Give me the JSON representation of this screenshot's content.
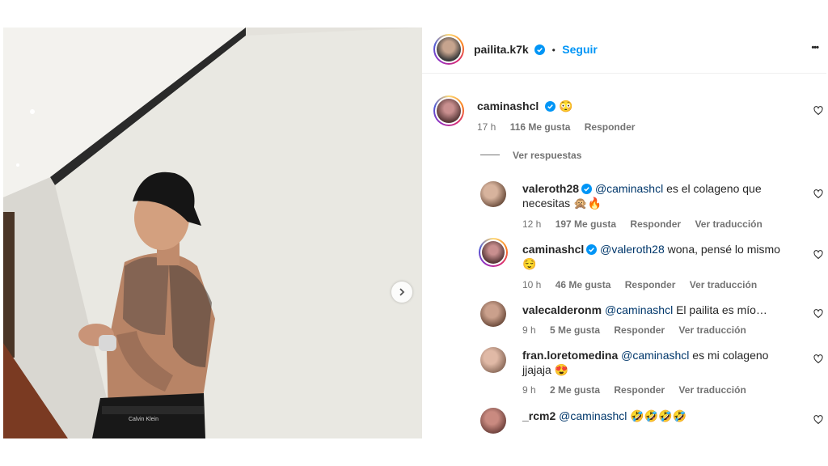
{
  "post": {
    "username": "pailita.k7k",
    "follow_label": "Seguir",
    "separator": "•",
    "more_label": "•••"
  },
  "main_comment": {
    "username": "caminashcl",
    "text": "😳",
    "time": "17 h",
    "likes": "116 Me gusta",
    "reply": "Responder"
  },
  "view_replies": "Ver respuestas",
  "replies": [
    {
      "username": "valeroth28",
      "verified": true,
      "mention": "@caminashcl",
      "text": " es el colageno que",
      "text2": "necesitas 🙊🔥",
      "time": "12 h",
      "likes": "197 Me gusta",
      "reply": "Responder",
      "translate": "Ver traducción"
    },
    {
      "username": "caminashcl",
      "verified": true,
      "mention": "@valeroth28",
      "text": " wona, pensé lo mismo",
      "text2": "😌",
      "time": "10 h",
      "likes": "46 Me gusta",
      "reply": "Responder",
      "translate": "Ver traducción"
    },
    {
      "username": "valecalderonm",
      "verified": false,
      "mention": "@caminashcl",
      "text": " El pailita es mío…",
      "text2": "",
      "time": "9 h",
      "likes": "5 Me gusta",
      "reply": "Responder",
      "translate": "Ver traducción"
    },
    {
      "username": "fran.loretomedina",
      "verified": false,
      "mention": "@caminashcl",
      "text": " es mi colageno",
      "text2": "jjajaja 😍",
      "time": "9 h",
      "likes": "2 Me gusta",
      "reply": "Responder",
      "translate": "Ver traducción"
    },
    {
      "username": "_rcm2",
      "verified": false,
      "mention": "@caminashcl",
      "text": " 🤣🤣🤣🤣",
      "text2": "",
      "time": "",
      "likes": "",
      "reply": "",
      "translate": ""
    }
  ],
  "photo": {
    "waistband_text": "Calvin Klein"
  },
  "colors": {
    "verified": "#0095f6",
    "follow": "#0095f6",
    "mention": "#00376b",
    "muted": "#737373"
  }
}
